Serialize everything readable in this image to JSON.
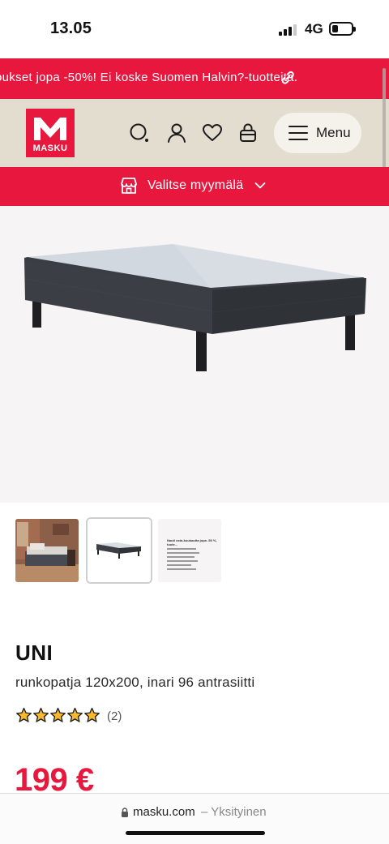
{
  "status_bar": {
    "time": "13.05",
    "network": "4G",
    "signal_bars_active": 3
  },
  "promo": {
    "text": "oukset jopa -50%! Ei koske Suomen Halvin?-tuotteita.",
    "icon": "link-icon"
  },
  "header": {
    "logo_text": "MASKU",
    "icons": [
      "search-icon",
      "user-icon",
      "heart-icon",
      "basket-icon"
    ],
    "menu_label": "Menu"
  },
  "store_selector": {
    "label": "Valitse myymälä",
    "icon": "store-icon"
  },
  "thumbnails": {
    "selected_index": 1,
    "info_title": "Nauti osta-kuukautta jopa -50 %, tuote..."
  },
  "product": {
    "name": "UNI",
    "description": "runkopatja 120x200, inari 96 antrasiitti",
    "rating": 5,
    "review_count": "(2)",
    "price": "199 €"
  },
  "browser": {
    "domain": "masku.com",
    "mode": "– Yksityinen"
  },
  "colors": {
    "brand_red": "#e8173d",
    "header_beige": "#e3ddd0",
    "star_gold": "#f5b82e"
  }
}
